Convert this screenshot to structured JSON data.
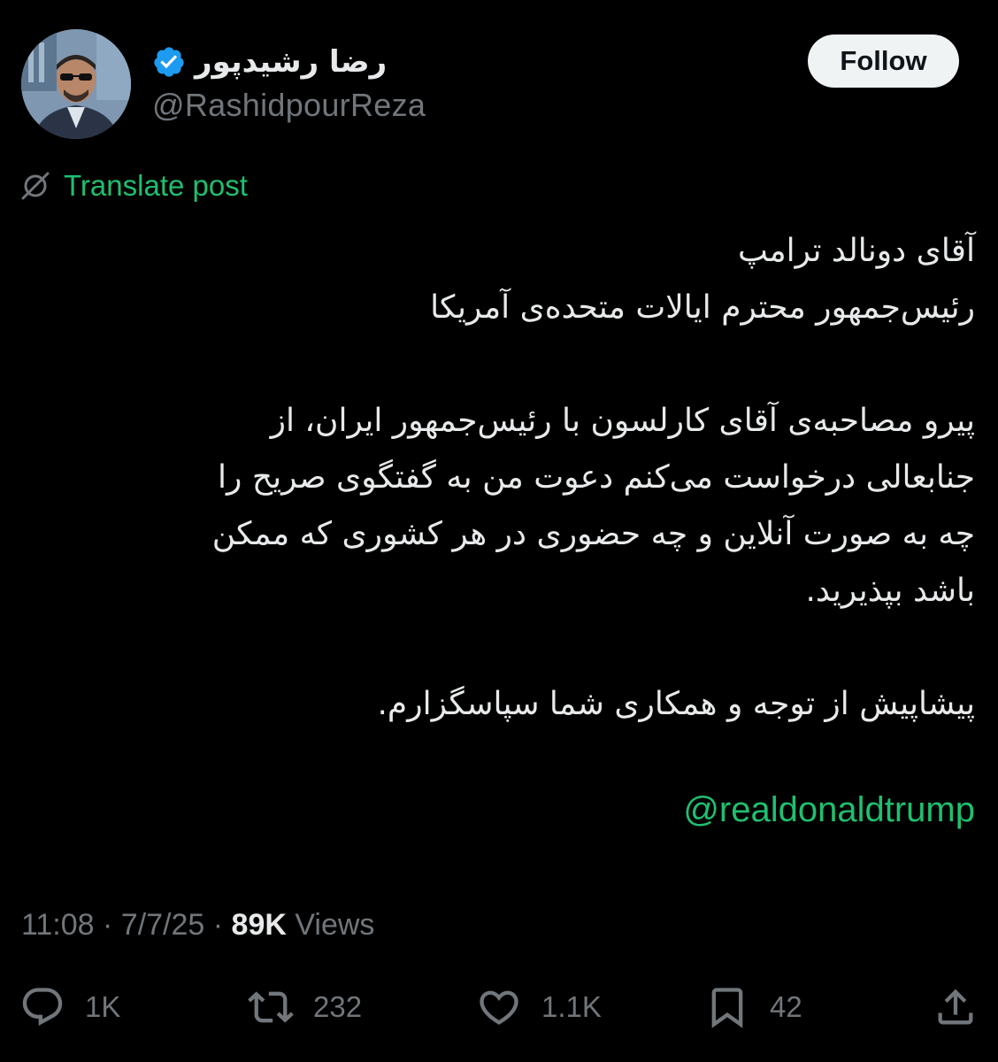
{
  "author": {
    "display_name": "رضا رشیدپور",
    "handle": "@RashidpourReza",
    "verified": true
  },
  "follow_button": {
    "label": "Follow"
  },
  "translate": {
    "label": "Translate post",
    "icon": "translate-icon"
  },
  "body": {
    "lines": [
      "آقای دونالد ترامپ",
      "رئیس‌جمهور محترم ایالات متحده‌ی آمریکا",
      "",
      "پیرو مصاحبه‌ی آقای کارلسون با رئیس‌جمهور ایران، از",
      "جنابعالی درخواست می‌کنم دعوت من به گفتگوی صریح را",
      "چه به صورت آنلاین و چه حضوری در هر کشوری که ممکن",
      "باشد بپذیرید.",
      "",
      "پیشاپیش از توجه و همکاری شما سپاسگزارم."
    ],
    "mention": "@realdonaldtrump"
  },
  "meta": {
    "time": "11:08",
    "separator": " · ",
    "date": "7/7/25",
    "views_count": "89K",
    "views_label": " Views"
  },
  "actions": {
    "replies": {
      "count": "1K",
      "icon": "reply-icon"
    },
    "reposts": {
      "count": "232",
      "icon": "repost-icon"
    },
    "likes": {
      "count": "1.1K",
      "icon": "like-icon"
    },
    "bookmarks": {
      "count": "42",
      "icon": "bookmark-icon"
    },
    "share": {
      "icon": "share-icon"
    }
  },
  "colors": {
    "background": "#000000",
    "text": "#e7e9ea",
    "secondary": "#71767b",
    "accent": "#1fbf6f",
    "verified": "#1d9bf0"
  }
}
